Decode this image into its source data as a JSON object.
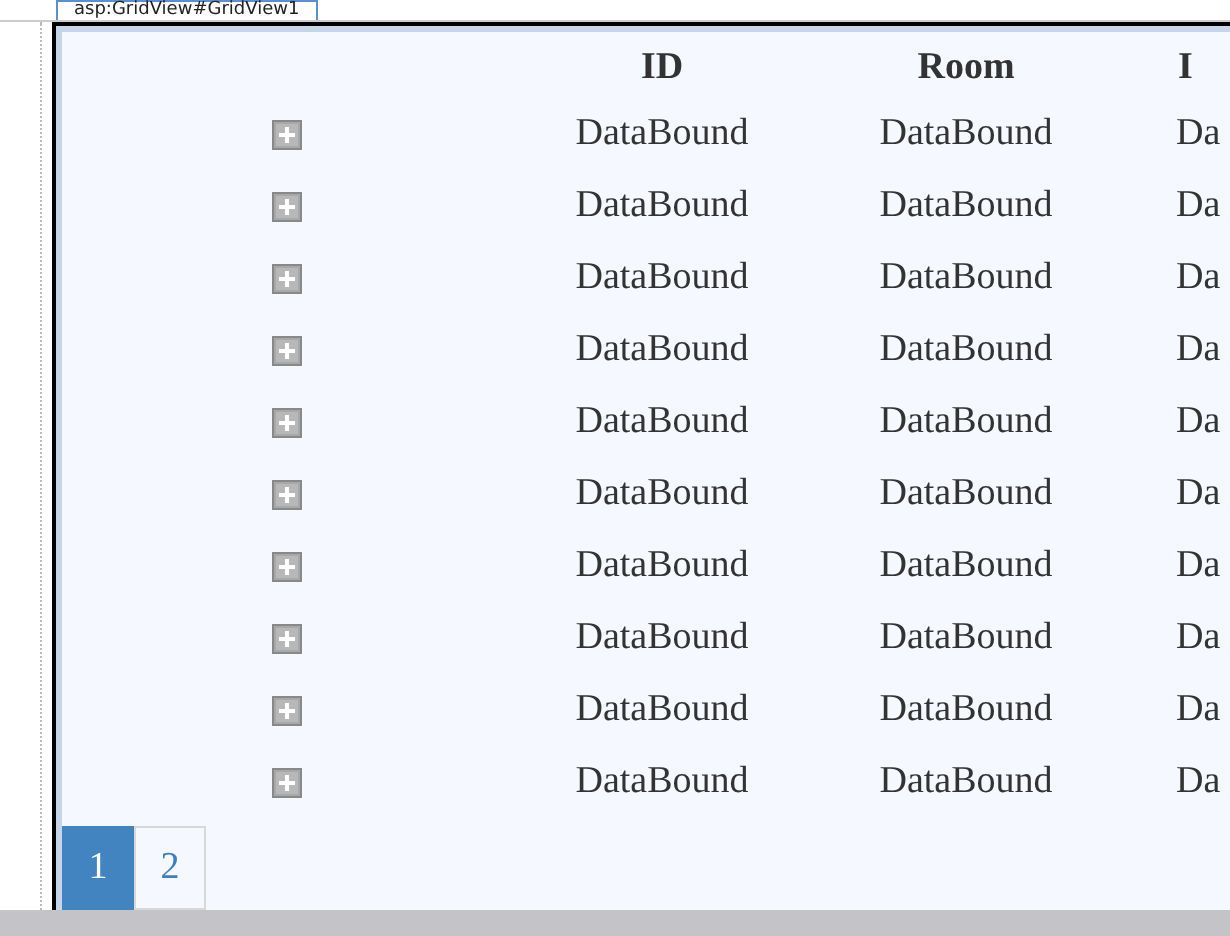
{
  "control_tag": "asp:GridView#GridView1",
  "table": {
    "columns": [
      "",
      "ID",
      "Room",
      "I"
    ],
    "rows": [
      {
        "id": "DataBound",
        "room": "DataBound",
        "column_3": "Da"
      },
      {
        "id": "DataBound",
        "room": "DataBound",
        "column_3": "Da"
      },
      {
        "id": "DataBound",
        "room": "DataBound",
        "column_3": "Da"
      },
      {
        "id": "DataBound",
        "room": "DataBound",
        "column_3": "Da"
      },
      {
        "id": "DataBound",
        "room": "DataBound",
        "column_3": "Da"
      },
      {
        "id": "DataBound",
        "room": "DataBound",
        "column_3": "Da"
      },
      {
        "id": "DataBound",
        "room": "DataBound",
        "column_3": "Da"
      },
      {
        "id": "DataBound",
        "room": "DataBound",
        "column_3": "Da"
      },
      {
        "id": "DataBound",
        "room": "DataBound",
        "column_3": "Da"
      },
      {
        "id": "DataBound",
        "room": "DataBound",
        "column_3": "Da"
      }
    ]
  },
  "pager": [
    {
      "label": "1",
      "selected": true
    },
    {
      "label": "2",
      "selected": false
    }
  ]
}
